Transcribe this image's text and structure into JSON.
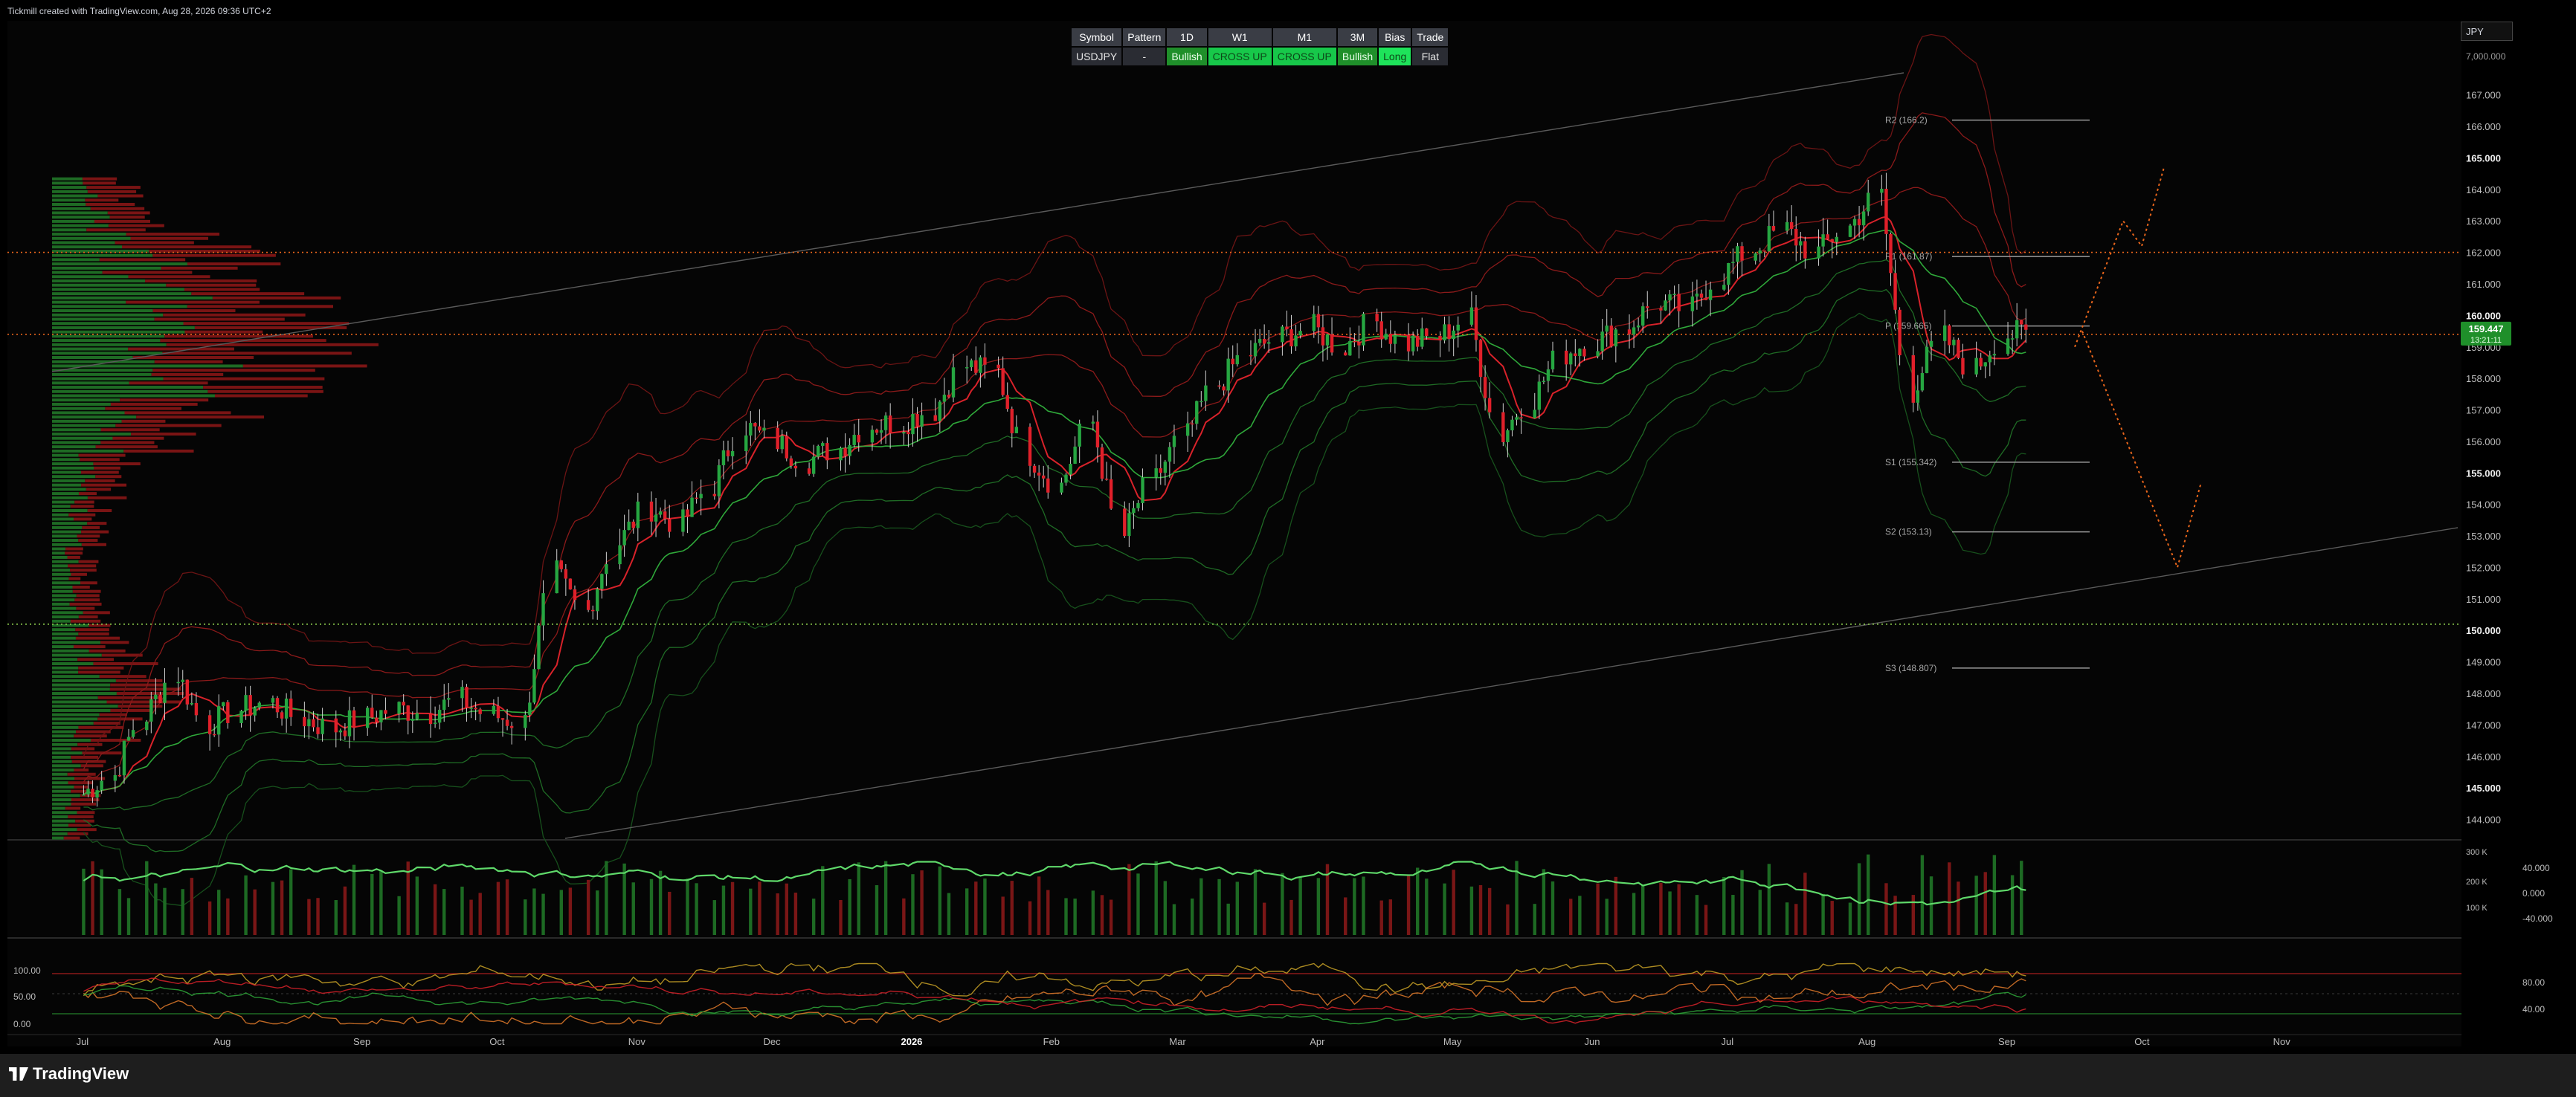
{
  "header": {
    "caption": "Tickmill created with TradingView.com, Aug 28, 2026 09:36 UTC+2"
  },
  "symbol_box": "JPY",
  "summary_table": {
    "headers": [
      "Symbol",
      "Pattern",
      "1D",
      "W1",
      "M1",
      "3M",
      "Bias",
      "Trade"
    ],
    "row": [
      "USDJPY",
      "-",
      "Bullish",
      "CROSS UP",
      "CROSS UP",
      "Bullish",
      "Long",
      "Flat"
    ]
  },
  "footer": {
    "brand": "TradingView"
  },
  "colors": {
    "bull": "#26a641",
    "bear": "#e0202a",
    "band_red": "#8b1a1a",
    "band_green": "#1f6b25",
    "orange": "#e8651b",
    "price_tag": "#1f8f2a",
    "grid": "#1c1c1c"
  },
  "chart_data": [
    {
      "type": "candlestick",
      "symbol": "USDJPY",
      "x_ticks": [
        "Jul",
        "Aug",
        "Sep",
        "Oct",
        "Nov",
        "Dec",
        "2026",
        "Feb",
        "Mar",
        "Apr",
        "May",
        "Jun",
        "Jul",
        "Aug",
        "Sep",
        "Oct",
        "Nov"
      ],
      "y_ticks": [
        "167.000",
        "166.000",
        "165.000",
        "164.000",
        "163.000",
        "162.000",
        "161.000",
        "160.000",
        "159.000",
        "158.000",
        "157.000",
        "156.000",
        "155.000",
        "154.000",
        "153.000",
        "152.000",
        "151.000",
        "150.000",
        "149.000",
        "148.000",
        "147.000",
        "146.000",
        "145.000",
        "144.000"
      ],
      "ylim": [
        143.4,
        167.7
      ],
      "top_axis_label": "7,000.000",
      "current_price": {
        "value": 159.447,
        "label": "159.447",
        "countdown": "13:21:11"
      },
      "pivot_levels": [
        {
          "label": "R2 (166.2)",
          "value": 166.2
        },
        {
          "label": "R1 (161.87)",
          "value": 161.87
        },
        {
          "label": "P (159.665)",
          "value": 159.665
        },
        {
          "label": "S1 (155.342)",
          "value": 155.342
        },
        {
          "label": "S2 (153.13)",
          "value": 153.13
        },
        {
          "label": "S3 (148.807)",
          "value": 148.807
        }
      ],
      "horizontal_lines": [
        162.0,
        159.4,
        150.2
      ],
      "weekly_closes": [
        {
          "date": "2025-06-23",
          "close": 144.8
        },
        {
          "date": "2025-06-30",
          "close": 145.4
        },
        {
          "date": "2025-07-07",
          "close": 147.3
        },
        {
          "date": "2025-07-14",
          "close": 148.6
        },
        {
          "date": "2025-07-21",
          "close": 147.0
        },
        {
          "date": "2025-07-28",
          "close": 147.5
        },
        {
          "date": "2025-08-04",
          "close": 147.7
        },
        {
          "date": "2025-08-11",
          "close": 147.2
        },
        {
          "date": "2025-08-18",
          "close": 146.9
        },
        {
          "date": "2025-08-25",
          "close": 147.2
        },
        {
          "date": "2025-09-01",
          "close": 147.5
        },
        {
          "date": "2025-09-08",
          "close": 147.4
        },
        {
          "date": "2025-09-15",
          "close": 147.8
        },
        {
          "date": "2025-09-22",
          "close": 147.3
        },
        {
          "date": "2025-09-29",
          "close": 147.1
        },
        {
          "date": "2025-10-06",
          "close": 151.8
        },
        {
          "date": "2025-10-13",
          "close": 150.6
        },
        {
          "date": "2025-10-20",
          "close": 152.8
        },
        {
          "date": "2025-10-27",
          "close": 153.9
        },
        {
          "date": "2025-11-03",
          "close": 153.4
        },
        {
          "date": "2025-11-10",
          "close": 154.6
        },
        {
          "date": "2025-11-17",
          "close": 156.5
        },
        {
          "date": "2025-11-24",
          "close": 156.0
        },
        {
          "date": "2025-12-01",
          "close": 155.4
        },
        {
          "date": "2025-12-08",
          "close": 155.8
        },
        {
          "date": "2025-12-15",
          "close": 156.5
        },
        {
          "date": "2025-12-22",
          "close": 156.6
        },
        {
          "date": "2025-12-29",
          "close": 157.0
        },
        {
          "date": "2026-01-05",
          "close": 158.4
        },
        {
          "date": "2026-01-12",
          "close": 158.2
        },
        {
          "date": "2026-01-19",
          "close": 155.6
        },
        {
          "date": "2026-01-26",
          "close": 154.6
        },
        {
          "date": "2026-02-02",
          "close": 156.6
        },
        {
          "date": "2026-02-09",
          "close": 153.0
        },
        {
          "date": "2026-02-16",
          "close": 154.8
        },
        {
          "date": "2026-02-23",
          "close": 156.2
        },
        {
          "date": "2026-03-02",
          "close": 157.8
        },
        {
          "date": "2026-03-09",
          "close": 158.8
        },
        {
          "date": "2026-03-16",
          "close": 159.3
        },
        {
          "date": "2026-03-23",
          "close": 159.6
        },
        {
          "date": "2026-03-30",
          "close": 159.0
        },
        {
          "date": "2026-04-06",
          "close": 159.8
        },
        {
          "date": "2026-04-13",
          "close": 159.1
        },
        {
          "date": "2026-04-20",
          "close": 159.3
        },
        {
          "date": "2026-04-27",
          "close": 159.9
        },
        {
          "date": "2026-05-04",
          "close": 156.2
        },
        {
          "date": "2026-05-11",
          "close": 157.4
        },
        {
          "date": "2026-05-18",
          "close": 158.8
        },
        {
          "date": "2026-05-25",
          "close": 159.2
        },
        {
          "date": "2026-06-01",
          "close": 159.6
        },
        {
          "date": "2026-06-08",
          "close": 160.4
        },
        {
          "date": "2026-06-15",
          "close": 160.2
        },
        {
          "date": "2026-06-22",
          "close": 161.3
        },
        {
          "date": "2026-06-29",
          "close": 162.1
        },
        {
          "date": "2026-07-06",
          "close": 162.7
        },
        {
          "date": "2026-07-13",
          "close": 162.0
        },
        {
          "date": "2026-07-20",
          "close": 162.8
        },
        {
          "date": "2026-07-27",
          "close": 163.8
        },
        {
          "date": "2026-08-03",
          "close": 157.6
        },
        {
          "date": "2026-08-10",
          "close": 159.3
        },
        {
          "date": "2026-08-17",
          "close": 158.3
        },
        {
          "date": "2026-08-24",
          "close": 159.4
        }
      ]
    },
    {
      "type": "bar",
      "name": "volume",
      "y_ticks": [
        "300 K",
        "200 K",
        "100 K"
      ],
      "oscillator_ticks": [
        "40.000",
        "0.000",
        "-40.000"
      ]
    },
    {
      "type": "line",
      "name": "stochastic",
      "y_ticks": [
        "100.00",
        "50.00",
        "0.00"
      ],
      "right_levels": [
        "80.00",
        "40.00"
      ]
    }
  ]
}
